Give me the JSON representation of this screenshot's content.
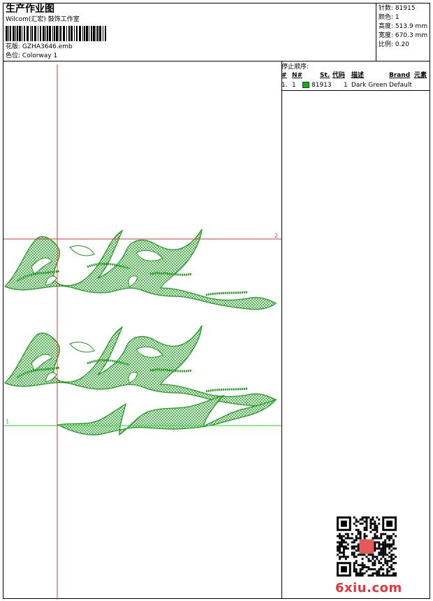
{
  "header": {
    "title": "生产作业图",
    "company": "Wilcom(汇宏) 鼓饰工作室",
    "pattern_label": "花版:",
    "pattern_value": "GZHA3646.emb",
    "color_label": "色位:",
    "color_value": "Colorway 1"
  },
  "stats": {
    "stitches_label": "针数:",
    "stitches_value": "81915",
    "colors_label": "颜色:",
    "colors_value": "1",
    "height_label": "高度:",
    "height_value": "513.9 mm",
    "width_label": "宽度:",
    "width_value": "670.3 mm",
    "scale_label": "比例:",
    "scale_value": "0.20"
  },
  "stop_sequence": {
    "title": "停止顺序:",
    "headers": [
      "#",
      "N#",
      "St.",
      "代码",
      "描述",
      "Brand",
      "元素"
    ],
    "rows": [
      {
        "index": "1.",
        "needle": "1",
        "stitches": "81913",
        "code": "1",
        "description": "Dark Green",
        "brand": "Default",
        "swatch_color": "#1fa61f"
      }
    ]
  },
  "design": {
    "thread_color": "#1e9b1e",
    "start_marker": "1",
    "end_marker": "2"
  },
  "watermark": {
    "text": "6xiu.com",
    "color": "#e8343a"
  }
}
